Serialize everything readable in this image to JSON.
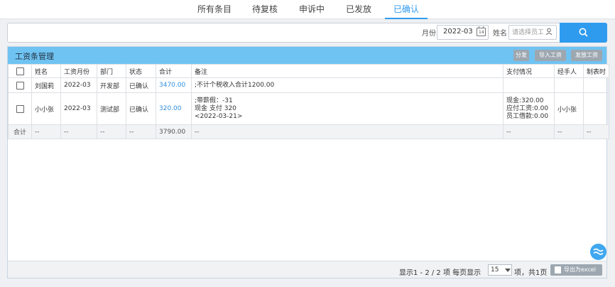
{
  "tabs": [
    {
      "label": "所有条目"
    },
    {
      "label": "待复核"
    },
    {
      "label": "申诉中"
    },
    {
      "label": "已发放"
    },
    {
      "label": "已确认"
    }
  ],
  "filters": {
    "month_label": "月份",
    "month_value": "2022-03",
    "name_label": "姓名",
    "name_placeholder": "请选择员工"
  },
  "panel": {
    "title": "工资条管理",
    "buttons": {
      "distribute": "分发",
      "import": "导入工资",
      "issue": "发放工资"
    }
  },
  "table": {
    "headers": [
      "姓名",
      "工资月份",
      "部门",
      "状态",
      "合计",
      "备注",
      "支付情况",
      "经手人",
      "制表时"
    ],
    "rows": [
      {
        "name": "刘国莉",
        "month": "2022-03",
        "dept": "开发部",
        "status": "已确认",
        "total": "3470.00",
        "remark": [
          ";不计个税收入合计1200.00"
        ],
        "payment": [],
        "handler": ""
      },
      {
        "name": "小小张",
        "month": "2022-03",
        "dept": "测试部",
        "status": "已确认",
        "total": "320.00",
        "remark": [
          ";带薪假：-31",
          "现金 支付 320",
          "<2022-03-21>"
        ],
        "payment": [
          "现金:320.00",
          "应付工资:0.00",
          "员工借款:0.00"
        ],
        "handler": "小小张"
      }
    ],
    "total_row": {
      "label": "合计",
      "placeholder": "--",
      "total": "3790.00"
    }
  },
  "footer": {
    "range_text": "显示1 - 2 / 2 项  每页显示",
    "page_size": "15",
    "pages_text": "项，共1页",
    "export_label": "导出为excel"
  },
  "colors": {
    "accent": "#2f9bef",
    "panel_header": "#6fc3f2"
  },
  "icons": [
    "calendar-icon",
    "person-icon",
    "search-icon",
    "excel-icon",
    "float-helper-icon"
  ]
}
